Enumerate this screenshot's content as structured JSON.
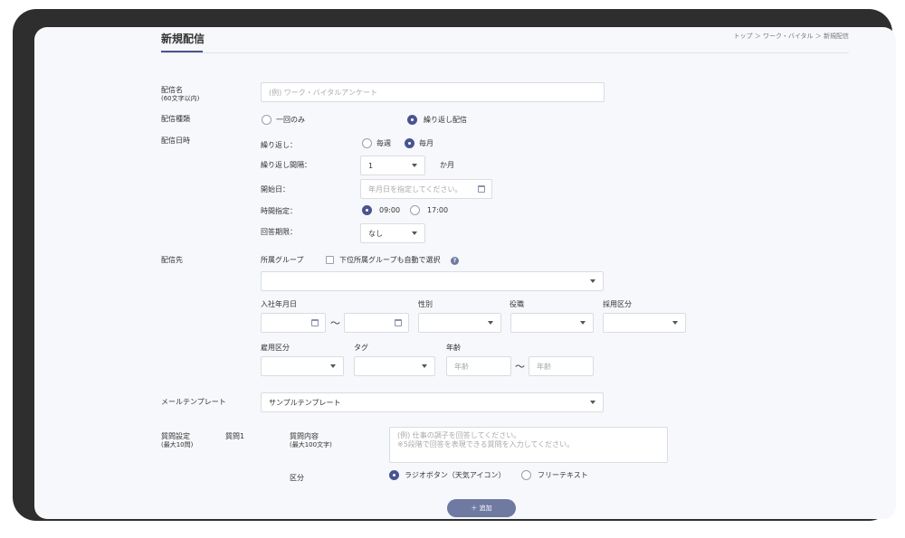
{
  "page": {
    "title": "新規配信",
    "breadcrumb": "トップ ＞ ワーク・バイタル ＞ 新規配信"
  },
  "labels": {
    "delivery_name": "配信名",
    "delivery_name_sub": "(60文字以内)",
    "delivery_type": "配信種類",
    "delivery_datetime": "配信日時",
    "repeat": "繰り返し：",
    "repeat_interval": "繰り返し間隔：",
    "month_unit": "か月",
    "start_date": "開始日：",
    "time_spec": "時間指定：",
    "answer_deadline": "回答期限：",
    "destination": "配信先",
    "group": "所属グループ",
    "auto_select_sub": "下位所属グループも自動で選択",
    "help_icon": "?",
    "join_date": "入社年月日",
    "gender": "性別",
    "position": "役職",
    "hire_type": "採用区分",
    "employment_type": "雇用区分",
    "tag": "タグ",
    "age": "年齢",
    "tilde": "～",
    "mail_template": "メールテンプレート",
    "question_settings": "質問設定",
    "question_settings_sub": "(最大10問)",
    "question_no": "質問1",
    "question_content": "質問内容",
    "question_content_sub": "(最大100文字)",
    "category": "区分"
  },
  "inputs": {
    "delivery_name_placeholder": "(例) ワーク・バイタルアンケート",
    "start_date_placeholder": "年月日を指定してください。",
    "age_from_placeholder": "年齢",
    "age_to_placeholder": "年齢",
    "question_placeholder_line1": "(例) 仕事の調子を回答してください。",
    "question_placeholder_line2": "※5段階で回答を表現できる質問を入力してください。"
  },
  "selects": {
    "repeat_interval_value": "1",
    "deadline_value": "なし",
    "mail_template_value": "サンプルテンプレート"
  },
  "radios": {
    "once": "一回のみ",
    "repeat_delivery": "繰り返し配信",
    "weekly": "毎週",
    "monthly": "毎月",
    "time_0900": "09:00",
    "time_1700": "17:00",
    "radio_button_type": "ラジオボタン（天気アイコン）",
    "free_text": "フリーテキスト"
  },
  "buttons": {
    "add": "＋ 追加"
  },
  "colors": {
    "accent": "#4a5490",
    "button": "#6f7aa3",
    "bezel": "#2e2e2e",
    "background": "#f6f8fb"
  }
}
